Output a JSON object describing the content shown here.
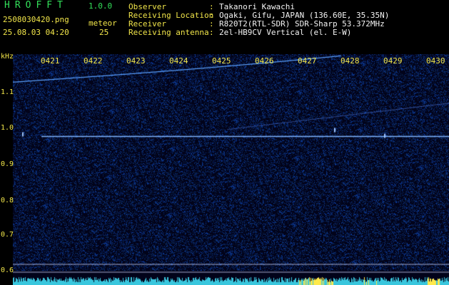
{
  "header": {
    "app_name": "HROFFT",
    "version": "1.0.0",
    "file_name": "2508030420.png",
    "datetime": "25.08.03 04:20",
    "meteor_label": "meteor",
    "meteor_count": "25"
  },
  "info": [
    {
      "key": "Observer",
      "value": "Takanori Kawachi"
    },
    {
      "key": "Receiving Location",
      "value": "Ogaki, Gifu, JAPAN (136.60E, 35.35N)"
    },
    {
      "key": "Receiver",
      "value": "R820T2(RTL-SDR) SDR-Sharp 53.372MHz"
    },
    {
      "key": "Receiving antenna",
      "value": "2el-HB9CV Vertical (el. E-W)"
    }
  ],
  "spectrogram": {
    "freq_unit": "kHz",
    "time_labels": [
      "0421",
      "0422",
      "0423",
      "0424",
      "0425",
      "0426",
      "0427",
      "0428",
      "0429",
      "0430"
    ],
    "freq_labels": [
      "1.1",
      "1.0",
      "0.9",
      "0.8",
      "0.7",
      "0.6"
    ],
    "freq_range_khz": [
      0.58,
      1.19
    ],
    "carrier_khz": 0.955,
    "colors": {
      "background": "#000000",
      "text_green": "#33e05a",
      "text_yellow": "#f2e64a",
      "signal": "#5aa0ff",
      "noise": "#1e2a8a",
      "power_bar": "#39c6dd",
      "burst": "#ffe94a"
    }
  }
}
